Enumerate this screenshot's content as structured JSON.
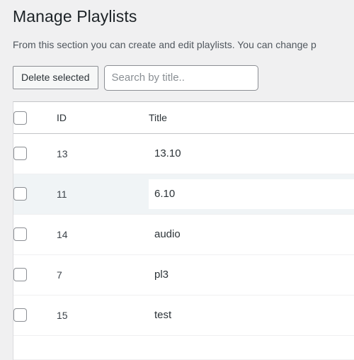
{
  "header": {
    "title": "Manage Playlists",
    "description": "From this section you can create and edit playlists. You can change p"
  },
  "toolbar": {
    "delete_selected_label": "Delete selected",
    "search_placeholder": "Search by title..",
    "search_value": ""
  },
  "table": {
    "columns": {
      "select_all": "",
      "id": "ID",
      "title": "Title"
    },
    "rows": [
      {
        "id": "13",
        "title": "13.10",
        "selected": false,
        "striped": false
      },
      {
        "id": "11",
        "title": "6.10",
        "selected": false,
        "striped": true
      },
      {
        "id": "14",
        "title": "audio",
        "selected": false,
        "striped": false
      },
      {
        "id": "7",
        "title": "pl3",
        "selected": false,
        "striped": false
      },
      {
        "id": "15",
        "title": "test",
        "selected": false,
        "striped": false
      }
    ]
  },
  "colors": {
    "page_background": "#f0f0f1",
    "table_background": "#ffffff",
    "stripe_row": "#f0f4f6",
    "heading_text": "#1d2327",
    "body_text": "#3c434a",
    "muted_text": "#50575e",
    "border": "#c3c4c7",
    "row_border": "#f0f0f1",
    "control_border": "#8c8f94"
  }
}
